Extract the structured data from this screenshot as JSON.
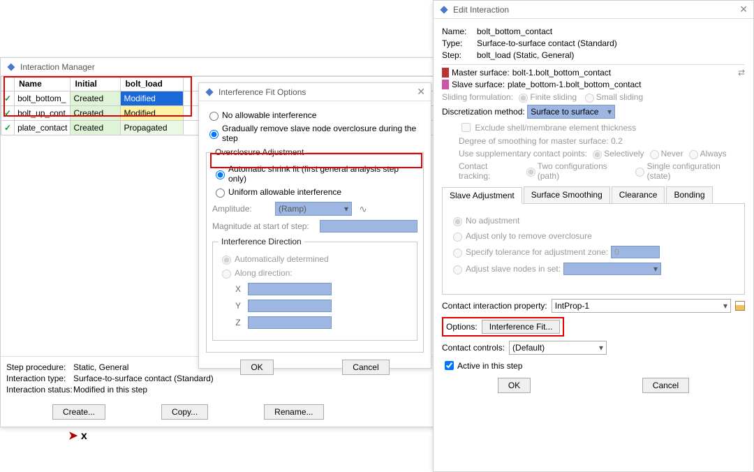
{
  "mgr": {
    "title": "Interaction Manager",
    "cols": [
      "Name",
      "Initial",
      "bolt_load"
    ],
    "rows": [
      {
        "name": "bolt_bottom_",
        "initial": "Created",
        "load": "Modified",
        "loadClass": "td-modblue"
      },
      {
        "name": "bolt_up_cont",
        "initial": "Created",
        "load": "Modified",
        "loadClass": "td-modyel"
      },
      {
        "name": "plate_contact",
        "initial": "Created",
        "load": "Propagated",
        "loadClass": "td-prop"
      }
    ],
    "step_proc_label": "Step procedure:",
    "step_proc": "Static, General",
    "int_type_label": "Interaction type:",
    "int_type": "Surface-to-surface contact (Standard)",
    "int_status_label": "Interaction status:",
    "int_status": "Modified in this step",
    "btn_create": "Create...",
    "btn_copy": "Copy...",
    "btn_rename": "Rename..."
  },
  "fit": {
    "title": "Interference Fit Options",
    "r_none": "No allowable interference",
    "r_grad": "Gradually remove slave node overclosure during the step",
    "fs_over": "Overclosure Adjustment",
    "r_auto": "Automatic shrink fit (first general analysis step only)",
    "r_unif": "Uniform allowable interference",
    "amp_label": "Amplitude:",
    "amp_combo": "(Ramp)",
    "mag_label": "Magnitude at start of step:",
    "fs_dir": "Interference Direction",
    "r_autod": "Automatically determined",
    "r_along": "Along direction:",
    "axes": [
      "X",
      "Y",
      "Z"
    ],
    "ok": "OK",
    "cancel": "Cancel"
  },
  "edit": {
    "title": "Edit Interaction",
    "name_l": "Name:",
    "name": "bolt_bottom_contact",
    "type_l": "Type:",
    "type": "Surface-to-surface contact (Standard)",
    "step_l": "Step:",
    "step": "bolt_load (Static, General)",
    "master_l": "Master surface:",
    "master": "bolt-1.bolt_bottom_contact",
    "slave_l": "Slave surface:",
    "slave": "plate_bottom-1.bolt_bottom_contact",
    "slide_l": "Sliding formulation:",
    "slide_a": "Finite sliding",
    "slide_b": "Small sliding",
    "disc_l": "Discretization method:",
    "disc": "Surface to surface",
    "exclude": "Exclude shell/membrane element thickness",
    "smooth_l": "Degree of smoothing for master surface:",
    "smooth": "0.2",
    "supp_l": "Use supplementary contact points:",
    "supp_a": "Selectively",
    "supp_b": "Never",
    "supp_c": "Always",
    "track_l": "Contact tracking:",
    "track_a": "Two configurations (path)",
    "track_b": "Single configuration (state)",
    "tabs": [
      "Slave Adjustment",
      "Surface Smoothing",
      "Clearance",
      "Bonding"
    ],
    "adj_none": "No adjustment",
    "adj_over": "Adjust only to remove overclosure",
    "adj_tol": "Specify tolerance for adjustment zone:",
    "adj_tol_v": "0",
    "adj_set": "Adjust slave nodes in set:",
    "prop_l": "Contact interaction property:",
    "prop": "IntProp-1",
    "opt_l": "Options:",
    "opt_btn": "Interference Fit...",
    "ctrl_l": "Contact controls:",
    "ctrl": "(Default)",
    "active": "Active in this step",
    "ok": "OK",
    "cancel": "Cancel"
  }
}
